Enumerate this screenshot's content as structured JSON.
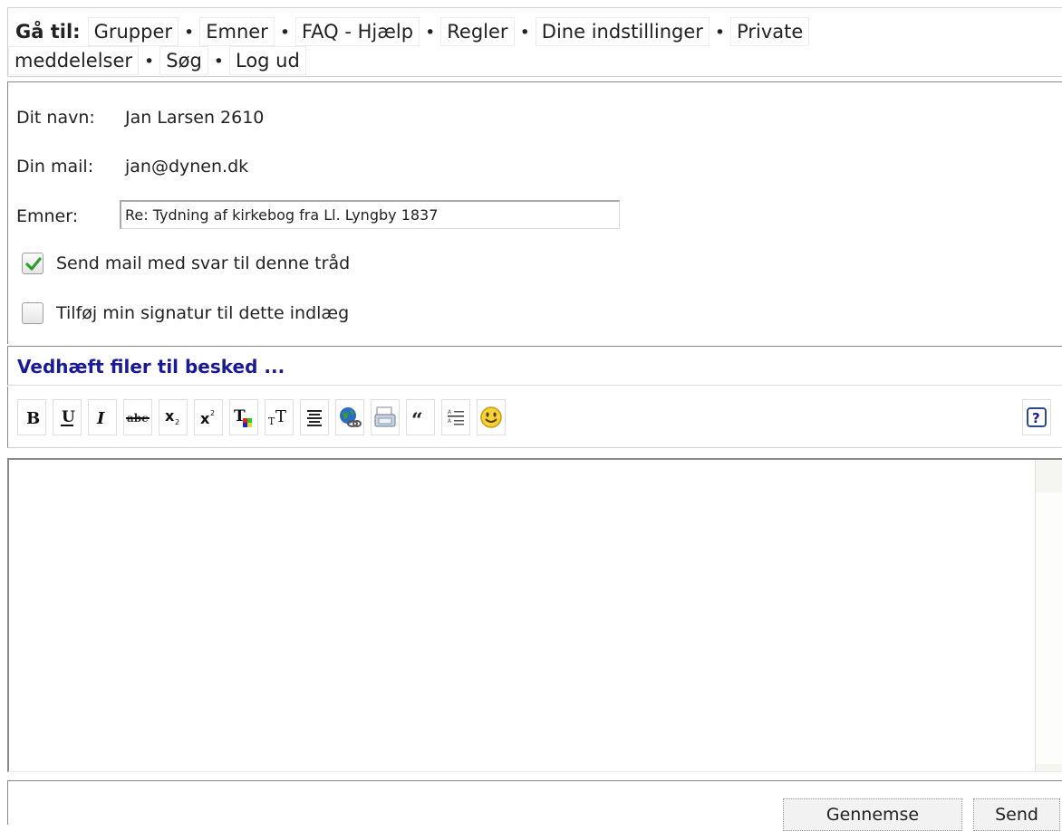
{
  "nav": {
    "label": "Gå til:",
    "links": [
      "Grupper",
      "Emner",
      "FAQ - Hjælp",
      "Regler",
      "Dine indstillinger",
      "Private meddelelser",
      "Søg",
      "Log ud"
    ],
    "links_line1": [
      "Grupper",
      "Emner",
      "FAQ - Hjælp",
      "Regler",
      "Dine indstillinger",
      "Private"
    ],
    "links_line2": [
      "meddelelser",
      "Søg",
      "Log ud"
    ],
    "separator": "•"
  },
  "form": {
    "name_label": "Dit navn:",
    "name_value": "Jan Larsen 2610",
    "mail_label": "Din mail:",
    "mail_value": "jan@dynen.dk",
    "subject_label": "Emner:",
    "subject_value": "Re: Tydning af kirkebog fra Ll. Lyngby 1837",
    "notify_label": "Send mail med svar til denne tråd",
    "notify_checked": true,
    "signature_label": "Tilføj min signatur til dette indlæg",
    "signature_checked": false
  },
  "attach": {
    "label": "Vedhæft filer til besked ..."
  },
  "toolbar": {
    "buttons": [
      "bold-icon",
      "underline-icon",
      "italic-icon",
      "strikethrough-icon",
      "subscript-icon",
      "superscript-icon",
      "text-color-icon",
      "font-size-icon",
      "align-center-icon",
      "insert-link-icon",
      "insert-image-icon",
      "quote-icon",
      "list-icon",
      "smiley-icon"
    ],
    "help_icon": "help-icon"
  },
  "editor": {
    "value": ""
  },
  "footer": {
    "preview_label": "Gennemse",
    "send_label": "Send"
  },
  "colors": {
    "accent": "#1a1a96",
    "checkmark": "#2e9e2e",
    "border": "#888888"
  }
}
